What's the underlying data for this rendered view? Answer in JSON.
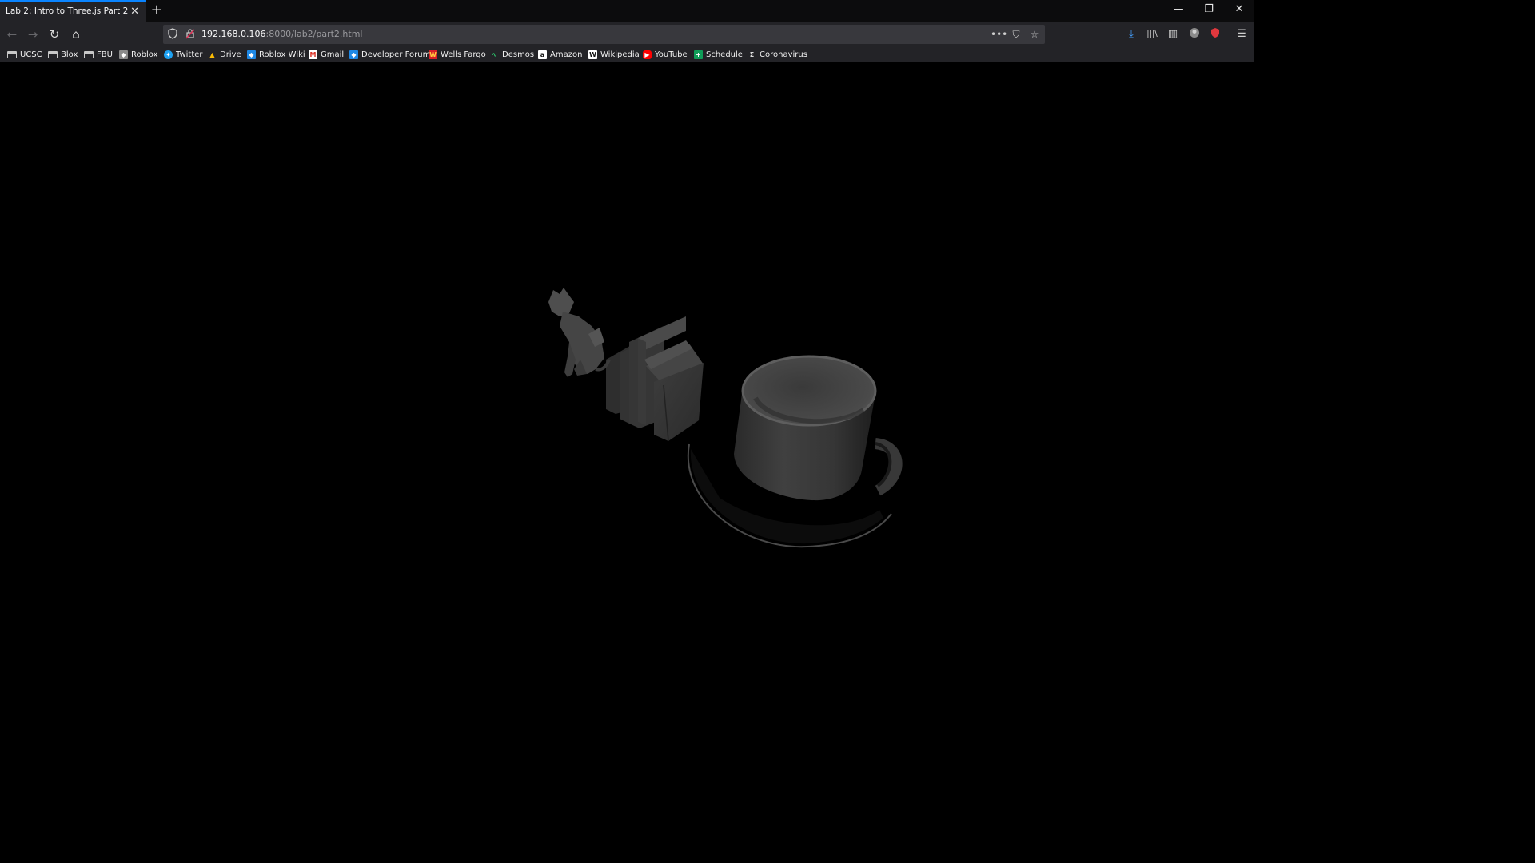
{
  "browser": {
    "tab": {
      "title": "Lab 2: Intro to Three.js Part 2",
      "close": "✕"
    },
    "new_tab": "+",
    "window_controls": {
      "minimize": "—",
      "restore": "❐",
      "close": "✕"
    },
    "nav": {
      "back": "←",
      "forward": "→",
      "reload": "↻",
      "home": "⌂"
    },
    "url": {
      "host": "192.168.0.106",
      "rest": ":8000/lab2/part2.html"
    },
    "url_actions": {
      "more": "•••",
      "pocket": "⛉",
      "bookmark": "☆"
    },
    "toolbar": {
      "downloads": "⤓",
      "library": "|||\\",
      "sidebar": "▥",
      "menu": "☰"
    },
    "accent_color": "#0a84ff"
  },
  "bookmarks": [
    {
      "label": "UCSC",
      "icon": "folder-icon",
      "glyph": ""
    },
    {
      "label": "Blox",
      "icon": "folder-icon",
      "glyph": ""
    },
    {
      "label": "FBU",
      "icon": "folder-icon",
      "glyph": ""
    },
    {
      "label": "Roblox",
      "icon": "roblox-icon",
      "glyph": "◆"
    },
    {
      "label": "Twitter",
      "icon": "twitter-icon",
      "glyph": "✦"
    },
    {
      "label": "Drive",
      "icon": "drive-icon",
      "glyph": "▲"
    },
    {
      "label": "Roblox Wiki",
      "icon": "roblox-wiki-icon",
      "glyph": "◆"
    },
    {
      "label": "Gmail",
      "icon": "gmail-icon",
      "glyph": "M"
    },
    {
      "label": "Developer Forum",
      "icon": "devforum-icon",
      "glyph": "◆"
    },
    {
      "label": "Wells Fargo",
      "icon": "wellsfargo-icon",
      "glyph": "W"
    },
    {
      "label": "Desmos",
      "icon": "desmos-icon",
      "glyph": "∿"
    },
    {
      "label": "Amazon",
      "icon": "amazon-icon",
      "glyph": "a"
    },
    {
      "label": "Wikipedia",
      "icon": "wikipedia-icon",
      "glyph": "W"
    },
    {
      "label": "YouTube",
      "icon": "youtube-icon",
      "glyph": "▶"
    },
    {
      "label": "Schedule",
      "icon": "schedule-icon",
      "glyph": "+"
    },
    {
      "label": "Coronavirus",
      "icon": "coronavirus-icon",
      "glyph": "Σ"
    }
  ],
  "scene": {
    "objects": [
      "cat",
      "books",
      "mug",
      "saucer"
    ],
    "background_color": "#000000"
  }
}
